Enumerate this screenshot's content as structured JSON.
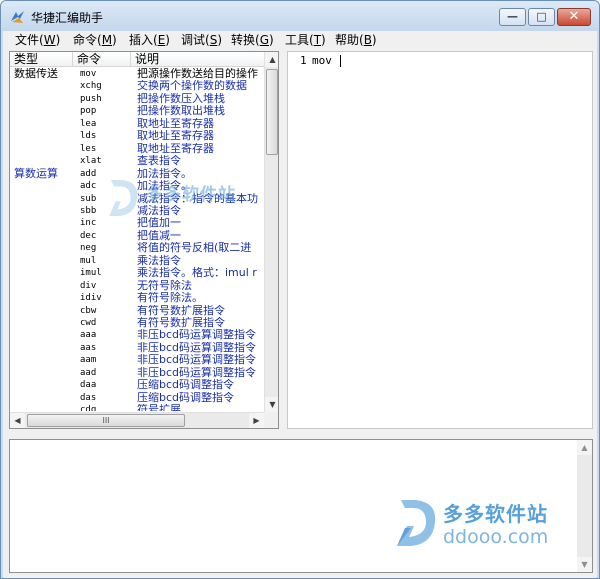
{
  "window": {
    "title": "华捷汇编助手",
    "minimize_glyph": "—",
    "maximize_glyph": "□",
    "close_glyph": "✕",
    "icon": "wing-app-icon"
  },
  "menu": [
    {
      "label": "文件(",
      "key": "W",
      "end": ")"
    },
    {
      "label": "命令(",
      "key": "M",
      "end": ")"
    },
    {
      "label": "插入(",
      "key": "E",
      "end": ")"
    },
    {
      "label": "调试(",
      "key": "S",
      "end": ")"
    },
    {
      "label": "转换(",
      "key": "G",
      "end": ")"
    },
    {
      "label": "工具(",
      "key": "T",
      "end": ")"
    },
    {
      "label": "帮助(",
      "key": "B",
      "end": ")"
    }
  ],
  "list": {
    "headers": [
      "类型",
      "命令",
      "说明"
    ],
    "rows": [
      {
        "cat": "数据传送",
        "cmd": "mov",
        "desc": "把源操作数送给目的操作"
      },
      {
        "cat": "",
        "cmd": "xchg",
        "desc": "交换两个操作数的数据"
      },
      {
        "cat": "",
        "cmd": "push",
        "desc": "把操作数压入堆栈"
      },
      {
        "cat": "",
        "cmd": "pop",
        "desc": "把操作数取出堆栈"
      },
      {
        "cat": "",
        "cmd": "lea",
        "desc": "取地址至寄存器"
      },
      {
        "cat": "",
        "cmd": "lds",
        "desc": "取地址至寄存器"
      },
      {
        "cat": "",
        "cmd": "les",
        "desc": "取地址至寄存器"
      },
      {
        "cat": "",
        "cmd": "xlat",
        "desc": "查表指令"
      },
      {
        "cat": "算数运算",
        "cmd": "add",
        "desc": "加法指令。"
      },
      {
        "cat": "",
        "cmd": "adc",
        "desc": "加法指令。"
      },
      {
        "cat": "",
        "cmd": "sub",
        "desc": "减法指令：指令的基本功"
      },
      {
        "cat": "",
        "cmd": "sbb",
        "desc": "减法指令"
      },
      {
        "cat": "",
        "cmd": "inc",
        "desc": "把值加一"
      },
      {
        "cat": "",
        "cmd": "dec",
        "desc": "把值减一"
      },
      {
        "cat": "",
        "cmd": "neg",
        "desc": "将值的符号反相(取二进"
      },
      {
        "cat": "",
        "cmd": "mul",
        "desc": "乘法指令"
      },
      {
        "cat": "",
        "cmd": "imul",
        "desc": "乘法指令。格式：imul r"
      },
      {
        "cat": "",
        "cmd": "div",
        "desc": "无符号除法"
      },
      {
        "cat": "",
        "cmd": "idiv",
        "desc": "有符号除法。"
      },
      {
        "cat": "",
        "cmd": "cbw",
        "desc": "有符号数扩展指令"
      },
      {
        "cat": "",
        "cmd": "cwd",
        "desc": "有符号数扩展指令"
      },
      {
        "cat": "",
        "cmd": "aaa",
        "desc": "非压bcd码运算调整指令"
      },
      {
        "cat": "",
        "cmd": "aas",
        "desc": "非压bcd码运算调整指令"
      },
      {
        "cat": "",
        "cmd": "aam",
        "desc": "非压bcd码运算调整指令"
      },
      {
        "cat": "",
        "cmd": "aad",
        "desc": "非压bcd码运算调整指令"
      },
      {
        "cat": "",
        "cmd": "daa",
        "desc": "压缩bcd码调整指令"
      },
      {
        "cat": "",
        "cmd": "das",
        "desc": "压缩bcd码调整指令"
      },
      {
        "cat": "",
        "cmd": "cdq",
        "desc": "符号扩展"
      }
    ],
    "hscroll_grip": "III"
  },
  "editor": {
    "line_number": "1",
    "code": "mov"
  },
  "watermark": {
    "cn": "多多软件站",
    "en": "ddooo.com"
  },
  "colors": {
    "blue_text": "#1a2fa8",
    "frame": "#c9dcef"
  }
}
